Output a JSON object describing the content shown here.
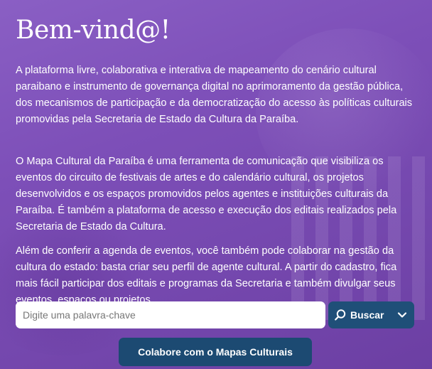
{
  "hero": {
    "title": "Bem-vind@!",
    "paragraphs": [
      "A plataforma livre, colaborativa e interativa de mapeamento do cenário cultural paraibano e instrumento de governança digital no aprimoramento da gestão pública, dos mecanismos de participação e da democratização do acesso às políticas culturais promovidas pela Secretaria de Estado da Cultura da Paraíba.",
      "O Mapa Cultural da Paraíba é uma ferramenta de comunicação que visibiliza os eventos do circuito de festivais de artes e do calendário cultural, os projetos desenvolvidos e os espaços promovidos pelos agentes e instituições culturais da Paraíba. É também a plataforma de acesso e execução dos editais realizados pela Secretaria de Estado da Cultura.",
      "Além de conferir a agenda de eventos, você também pode colaborar na gestão da cultura do estado: basta criar seu perfil de agente cultural. A partir do cadastro, fica mais fácil participar dos editais e programas da Secretaria e também divulgar seus eventos, espaços ou projetos."
    ]
  },
  "search": {
    "placeholder": "Digite uma palavra-chave",
    "value": "",
    "button_label": "Buscar"
  },
  "cta": {
    "label": "Colabore com o Mapas Culturais"
  },
  "colors": {
    "background": "#7d4fb8",
    "button": "#1f4f78",
    "text": "#ffffff"
  },
  "icons": {
    "search": "search-icon",
    "dropdown": "chevron-down-icon"
  }
}
